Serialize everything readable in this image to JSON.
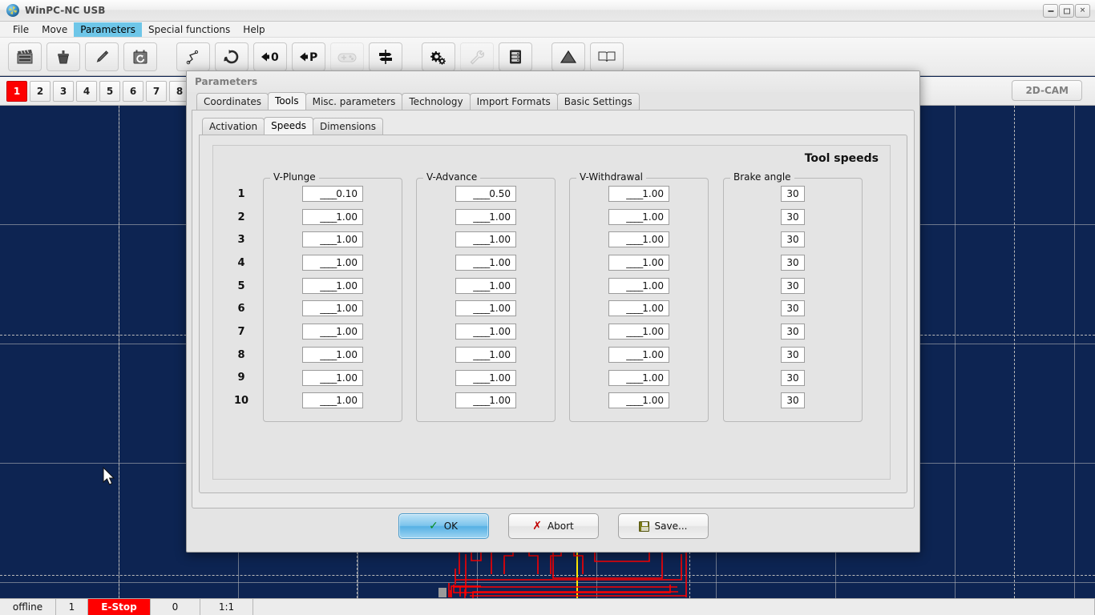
{
  "window": {
    "title": "WinPC-NC USB",
    "logo_icon": "app-logo-icon",
    "minimize_label": "–",
    "maximize_label": "□",
    "close_label": "✕"
  },
  "menubar": {
    "items": [
      {
        "label": "File",
        "active": false
      },
      {
        "label": "Move",
        "active": false
      },
      {
        "label": "Parameters",
        "active": true
      },
      {
        "label": "Special functions",
        "active": false
      },
      {
        "label": "Help",
        "active": false
      }
    ]
  },
  "toolbar": {
    "buttons": [
      {
        "name": "film-clapper-icon",
        "group": 1,
        "disabled": false
      },
      {
        "name": "trash-bin-icon",
        "group": 1,
        "disabled": false
      },
      {
        "name": "pencil-edit-icon",
        "group": 1,
        "disabled": false
      },
      {
        "name": "clock-reset-icon",
        "group": 1,
        "disabled": false
      },
      {
        "name": "polyline-path-icon",
        "group": 2,
        "disabled": false
      },
      {
        "name": "rotate-circular-arrow-icon",
        "group": 2,
        "disabled": false
      },
      {
        "name": "zero-reference-icon",
        "group": 2,
        "label": "0",
        "disabled": false
      },
      {
        "name": "park-reference-icon",
        "group": 2,
        "label": "P",
        "disabled": false
      },
      {
        "name": "joystick-gamepad-icon",
        "group": 2,
        "disabled": true
      },
      {
        "name": "signpost-direction-icon",
        "group": 2,
        "disabled": false
      },
      {
        "name": "gears-settings-icon",
        "group": 3,
        "disabled": false
      },
      {
        "name": "wrench-tool-icon",
        "group": 3,
        "disabled": true
      },
      {
        "name": "server-rack-icon",
        "group": 3,
        "disabled": false
      },
      {
        "name": "warning-triangle-icon",
        "group": 4,
        "disabled": false
      },
      {
        "name": "open-book-help-icon",
        "group": 4,
        "disabled": false
      }
    ]
  },
  "tool_selector": {
    "numbers": [
      "1",
      "2",
      "3",
      "4",
      "5",
      "6",
      "7",
      "8"
    ],
    "selected": "1",
    "selected_color": "#fd0000",
    "cam_button_label": "2D-CAM"
  },
  "statusbar": {
    "cells": [
      {
        "text": "offline",
        "kind": "text"
      },
      {
        "text": "1",
        "kind": "text"
      },
      {
        "text": "E-Stop",
        "kind": "estop"
      },
      {
        "text": "0",
        "kind": "text"
      },
      {
        "text": "1:1",
        "kind": "text"
      },
      {
        "text": "",
        "kind": "text"
      }
    ],
    "estop_color": "#ff0000"
  },
  "dialog": {
    "title": "Parameters",
    "tabs_level1": [
      {
        "label": "Coordinates",
        "active": false,
        "accel": ""
      },
      {
        "label": "Tools",
        "active": true,
        "accel": ""
      },
      {
        "label": "Misc. parameters",
        "active": false,
        "accel": ""
      },
      {
        "label": "Technology",
        "active": false,
        "accel": ""
      },
      {
        "label": "Import Formats",
        "active": false,
        "accel": ""
      },
      {
        "label": "Basic Settings",
        "active": false,
        "accel": "B"
      }
    ],
    "tabs_level2": [
      {
        "label": "Activation",
        "active": false
      },
      {
        "label": "Speeds",
        "active": true
      },
      {
        "label": "Dimensions",
        "active": false
      }
    ],
    "panel_title": "Tool speeds",
    "row_numbers": [
      "1",
      "2",
      "3",
      "4",
      "5",
      "6",
      "7",
      "8",
      "9",
      "10"
    ],
    "groups": [
      {
        "legend": "V-Plunge",
        "name": "group-v-plunge",
        "values": [
          "0.10",
          "1.00",
          "1.00",
          "1.00",
          "1.00",
          "1.00",
          "1.00",
          "1.00",
          "1.00",
          "1.00"
        ],
        "narrow": false
      },
      {
        "legend": "V-Advance",
        "name": "group-v-advance",
        "values": [
          "0.50",
          "1.00",
          "1.00",
          "1.00",
          "1.00",
          "1.00",
          "1.00",
          "1.00",
          "1.00",
          "1.00"
        ],
        "narrow": false
      },
      {
        "legend": "V-Withdrawal",
        "name": "group-v-withdrawal",
        "values": [
          "1.00",
          "1.00",
          "1.00",
          "1.00",
          "1.00",
          "1.00",
          "1.00",
          "1.00",
          "1.00",
          "1.00"
        ],
        "narrow": false
      },
      {
        "legend": "Brake angle",
        "name": "group-brake-angle",
        "values": [
          "30",
          "30",
          "30",
          "30",
          "30",
          "30",
          "30",
          "30",
          "30",
          "30"
        ],
        "narrow": true
      }
    ],
    "buttons": [
      {
        "label": "OK",
        "accel": "O",
        "icon": "check-mark-icon",
        "primary": true
      },
      {
        "label": "Abort",
        "accel": "A",
        "icon": "x-mark-icon",
        "primary": false
      },
      {
        "label": "Save...",
        "accel": "S",
        "icon": "floppy-disk-icon",
        "primary": false
      }
    ]
  },
  "workspace": {
    "background_color": "#0d2452",
    "toolpath_color": "#ff0000",
    "axis_color": "#ffe800",
    "grid_color": "#bebebe",
    "cursor_icon": "mouse-pointer-icon"
  }
}
